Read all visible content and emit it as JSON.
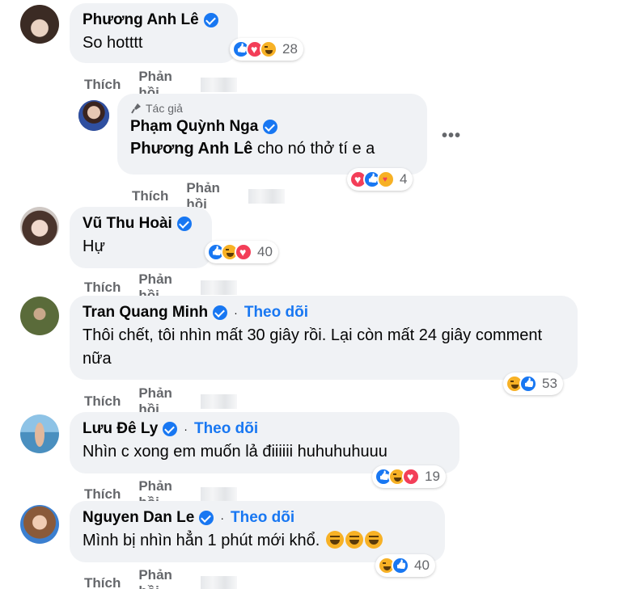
{
  "actions": {
    "like": "Thích",
    "reply": "Phản hồi"
  },
  "author_badge": "Tác giả",
  "follow_label": "Theo dõi",
  "separator": "·",
  "more_label": "•••",
  "comments": [
    {
      "author": "Phương Anh Lê",
      "text": "So hotttt",
      "reactions": [
        "like",
        "love",
        "haha"
      ],
      "count": "28"
    },
    {
      "author": "Phạm Quỳnh Nga",
      "mention": "Phương Anh Lê",
      "text": " cho nó thở tí e a",
      "reactions": [
        "love",
        "like",
        "care"
      ],
      "count": "4"
    },
    {
      "author": "Vũ Thu Hoài",
      "text": "Hự",
      "reactions": [
        "like",
        "haha",
        "love"
      ],
      "count": "40"
    },
    {
      "author": "Tran Quang Minh",
      "text": "Thôi chết, tôi nhìn mất 30 giây rồi. Lại còn mất 24 giây comment nữa",
      "reactions": [
        "haha",
        "like"
      ],
      "count": "53"
    },
    {
      "author": "Lưu Đê Ly",
      "text": "Nhìn c xong em muốn lả điiiiii huhuhuhuuu",
      "reactions": [
        "like",
        "haha",
        "love"
      ],
      "count": "19"
    },
    {
      "author": "Nguyen Dan Le",
      "text": "Mình bị nhìn hẳn 1 phút mới khổ.",
      "reactions": [
        "haha",
        "like"
      ],
      "count": "40"
    }
  ],
  "colors": {
    "bubble": "#f0f2f5",
    "accent": "#1877f2",
    "muted": "#65676b"
  }
}
